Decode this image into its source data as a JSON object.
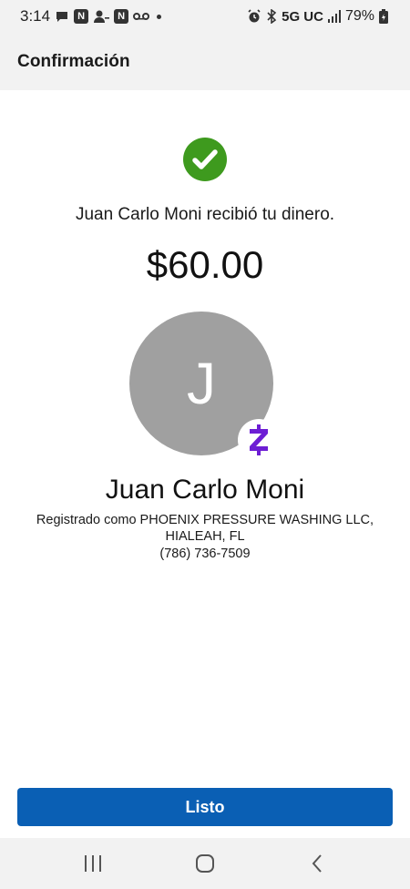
{
  "status_bar": {
    "time": "3:14",
    "network": "5G UC",
    "battery": "79%"
  },
  "header": {
    "title": "Confirmación"
  },
  "confirmation": {
    "message": "Juan Carlo Moni recibió tu dinero.",
    "amount": "$60.00",
    "avatar_initial": "J",
    "recipient_name": "Juan Carlo Moni",
    "registered_as": "Registrado como PHOENIX PRESSURE WASHING LLC, HIALEAH, FL",
    "phone": "(786) 736-7509"
  },
  "actions": {
    "done_label": "Listo"
  },
  "colors": {
    "success": "#3e9a1e",
    "primary_button": "#0a5fb4",
    "zelle": "#6d1ed4",
    "avatar_bg": "#a0a0a0"
  },
  "icons": {
    "success": "check-circle-icon",
    "badge": "zelle-icon",
    "nav": [
      "recent-apps-icon",
      "home-icon",
      "back-icon"
    ]
  }
}
